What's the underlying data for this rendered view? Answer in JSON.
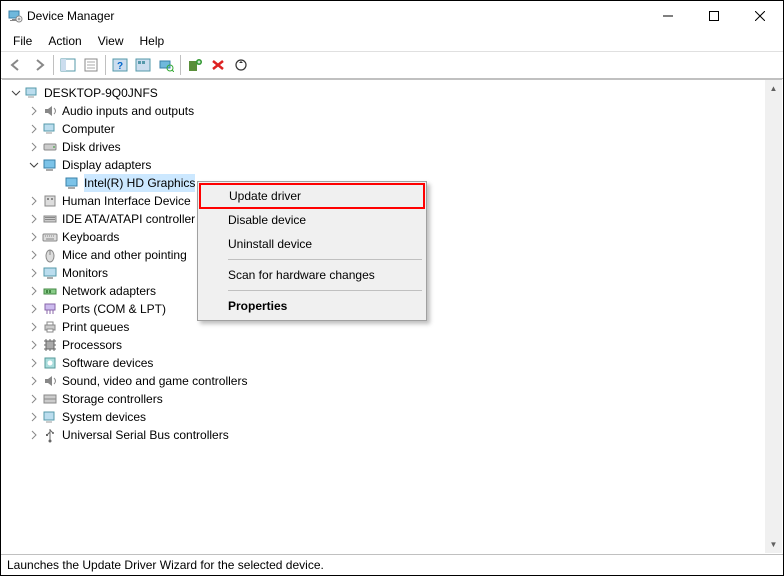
{
  "window": {
    "title": "Device Manager"
  },
  "menu": {
    "file": "File",
    "action": "Action",
    "view": "View",
    "help": "Help"
  },
  "toolbar": {
    "back": "Back",
    "forward": "Forward",
    "show_hide": "Show/Hide Console Tree",
    "properties": "Properties",
    "help": "Help",
    "action_center": "Action Center",
    "scan": "Scan for hardware changes",
    "add_legacy": "Add legacy hardware",
    "uninstall": "Uninstall device",
    "update": "Update device drivers"
  },
  "tree": {
    "root": "DESKTOP-9Q0JNFS",
    "items": [
      {
        "label": "Audio inputs and outputs",
        "expanded": false
      },
      {
        "label": "Computer",
        "expanded": false
      },
      {
        "label": "Disk drives",
        "expanded": false
      },
      {
        "label": "Display adapters",
        "expanded": true,
        "children": [
          {
            "label": "Intel(R) HD Graphics",
            "selected": true
          }
        ]
      },
      {
        "label": "Human Interface Device",
        "expanded": false,
        "truncated": true
      },
      {
        "label": "IDE ATA/ATAPI controller",
        "expanded": false,
        "truncated": true
      },
      {
        "label": "Keyboards",
        "expanded": false
      },
      {
        "label": "Mice and other pointing",
        "expanded": false,
        "truncated": true
      },
      {
        "label": "Monitors",
        "expanded": false
      },
      {
        "label": "Network adapters",
        "expanded": false
      },
      {
        "label": "Ports (COM & LPT)",
        "expanded": false
      },
      {
        "label": "Print queues",
        "expanded": false
      },
      {
        "label": "Processors",
        "expanded": false
      },
      {
        "label": "Software devices",
        "expanded": false
      },
      {
        "label": "Sound, video and game controllers",
        "expanded": false
      },
      {
        "label": "Storage controllers",
        "expanded": false
      },
      {
        "label": "System devices",
        "expanded": false
      },
      {
        "label": "Universal Serial Bus controllers",
        "expanded": false
      }
    ]
  },
  "context_menu": {
    "items": [
      {
        "label": "Update driver",
        "highlighted": true
      },
      {
        "label": "Disable device"
      },
      {
        "label": "Uninstall device"
      },
      {
        "sep": true
      },
      {
        "label": "Scan for hardware changes"
      },
      {
        "sep": true
      },
      {
        "label": "Properties",
        "bold": true
      }
    ]
  },
  "statusbar": {
    "text": "Launches the Update Driver Wizard for the selected device."
  }
}
